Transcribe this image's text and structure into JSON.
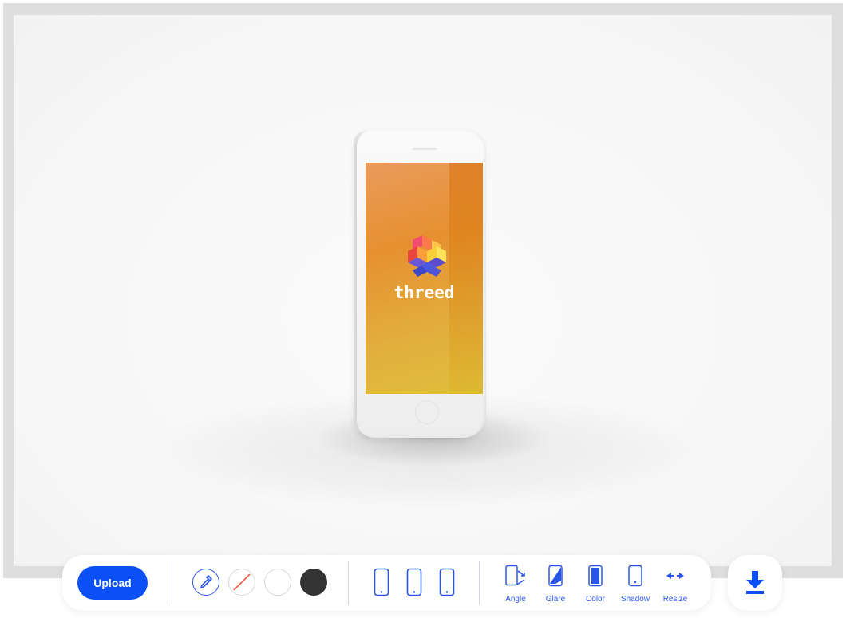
{
  "preview": {
    "phone_model": "iphone-white",
    "screen_logo_text": "threed"
  },
  "toolbar": {
    "upload_label": "Upload",
    "color_swatches": [
      {
        "name": "eyedropper",
        "color": "#ffffff",
        "icon": "eyedropper-icon"
      },
      {
        "name": "none",
        "color": "transparent",
        "icon": "no-color-icon"
      },
      {
        "name": "white",
        "color": "#ffffff"
      },
      {
        "name": "dark",
        "color": "#333333"
      }
    ],
    "device_icons": [
      "phone-portrait-icon",
      "phone-portrait-icon",
      "phone-portrait-icon"
    ],
    "tools": [
      {
        "label": "Angle",
        "icon": "angle-icon"
      },
      {
        "label": "Glare",
        "icon": "glare-icon"
      },
      {
        "label": "Color",
        "icon": "color-icon"
      },
      {
        "label": "Shadow",
        "icon": "shadow-icon"
      },
      {
        "label": "Resize",
        "icon": "resize-icon"
      }
    ],
    "download_icon": "download-icon"
  },
  "colors": {
    "accent": "#0a50f5",
    "tool_blue": "#2a56e8",
    "frame": "#dedede",
    "dark_swatch": "#333333"
  }
}
